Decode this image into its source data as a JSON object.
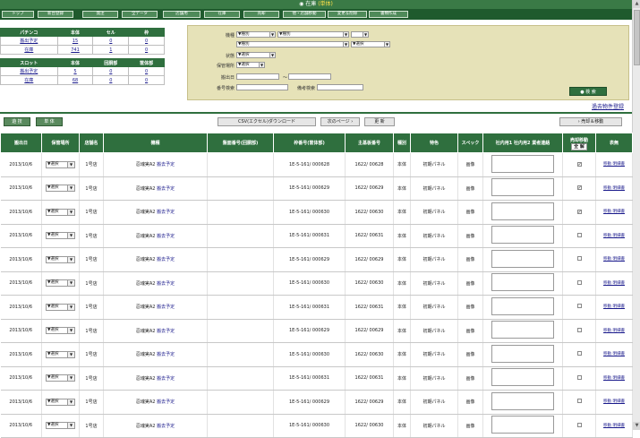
{
  "header": {
    "title": "在庫",
    "subtitle": "(単体)"
  },
  "nav": [
    "トップ",
    "新台登録",
    "発注",
    "全データ",
    "店舗用",
    "在庫",
    "売却",
    "他・店舗移動",
    "変更＆削除",
    "書類作成"
  ],
  "pachinko": {
    "headers": [
      "パチンコ",
      "本体",
      "セル",
      "枠"
    ],
    "rows": [
      {
        "label": "搬出予定",
        "c1": "15",
        "c2": "0",
        "c3": "0"
      },
      {
        "label": "在庫",
        "c1": "741",
        "c2": "1",
        "c3": "0"
      }
    ]
  },
  "slot": {
    "headers": [
      "スロット",
      "本体",
      "回胴部",
      "筐体部"
    ],
    "rows": [
      {
        "label": "搬出予定",
        "c1": "5",
        "c2": "0",
        "c3": "0"
      },
      {
        "label": "在庫",
        "c1": "68",
        "c2": "0",
        "c3": "0"
      }
    ]
  },
  "search": {
    "kind_label": "機種",
    "kind_sel1": "▼種別",
    "kind_sel2": "▼種別",
    "kind_sel3": "▼種別",
    "select_label": "▼選択",
    "state_label": "状態",
    "state_sel": "▼選択",
    "place_label": "保管場所",
    "place_sel": "▼選択",
    "date_label": "搬出日",
    "tilde": "〜",
    "number_label": "番号検索",
    "memo_label": "備考検索",
    "button": "検 索"
  },
  "past_link": "過去物件登録",
  "toolbar": {
    "btn1": "遊 技",
    "btn2": "単 体",
    "csv": "CSV(エクセル)ダウンロード",
    "next": "次のページ ›",
    "update": "更 新",
    "sell": "› 売却＆移動"
  },
  "columns": [
    "搬出日",
    "保管場所",
    "店舗名",
    "機種",
    "盤面番号(回胴部)",
    "枠番号(筐体部)",
    "主基板番号",
    "種別",
    "特色",
    "スペック",
    "社内用1 社内用2 業者連絡",
    "売却移動",
    "表無"
  ],
  "sellmove_all": "全 解",
  "rows": [
    {
      "date": "2013/10/6",
      "place": "▼選択",
      "store": "1号店",
      "maker": "忍魂実A2",
      "model": "搬去予定",
      "board": "",
      "frame": "1E-5-161/ 000628",
      "main": "1622/ 00628",
      "type": "本体",
      "feature": "初期パネル",
      "spec": "画像",
      "checked": true,
      "links": "移動 明細書"
    },
    {
      "date": "2013/10/6",
      "place": "▼選択",
      "store": "1号店",
      "maker": "忍魂実A2",
      "model": "搬去予定",
      "board": "",
      "frame": "1E-5-161/ 000629",
      "main": "1622/ 00629",
      "type": "本体",
      "feature": "初期パネル",
      "spec": "画像",
      "checked": true,
      "links": "移動 明細書"
    },
    {
      "date": "2013/10/6",
      "place": "▼選択",
      "store": "1号店",
      "maker": "忍魂実A2",
      "model": "搬去予定",
      "board": "",
      "frame": "1E-5-161/ 000630",
      "main": "1622/ 00630",
      "type": "本体",
      "feature": "初期パネル",
      "spec": "画像",
      "checked": true,
      "links": "移動 明細書"
    },
    {
      "date": "2013/10/6",
      "place": "▼選択",
      "store": "1号店",
      "maker": "忍魂実A2",
      "model": "搬去予定",
      "board": "",
      "frame": "1E-5-161/ 000631",
      "main": "1622/ 00631",
      "type": "本体",
      "feature": "初期パネル",
      "spec": "画像",
      "checked": false,
      "links": "移動 明細書"
    },
    {
      "date": "2013/10/6",
      "place": "▼選択",
      "store": "1号店",
      "maker": "忍魂実A2",
      "model": "搬去予定",
      "board": "",
      "frame": "1E-5-161/ 000629",
      "main": "1622/ 00629",
      "type": "本体",
      "feature": "初期パネル",
      "spec": "画像",
      "checked": false,
      "links": "移動 明細書"
    },
    {
      "date": "2013/10/6",
      "place": "▼選択",
      "store": "1号店",
      "maker": "忍魂実A2",
      "model": "搬去予定",
      "board": "",
      "frame": "1E-5-161/ 000630",
      "main": "1622/ 00630",
      "type": "本体",
      "feature": "初期パネル",
      "spec": "画像",
      "checked": false,
      "links": "移動 明細書"
    },
    {
      "date": "2013/10/6",
      "place": "▼選択",
      "store": "1号店",
      "maker": "忍魂実A2",
      "model": "搬去予定",
      "board": "",
      "frame": "1E-5-161/ 000631",
      "main": "1622/ 00631",
      "type": "本体",
      "feature": "初期パネル",
      "spec": "画像",
      "checked": false,
      "links": "移動 明細書"
    },
    {
      "date": "2013/10/6",
      "place": "▼選択",
      "store": "1号店",
      "maker": "忍魂実A2",
      "model": "搬去予定",
      "board": "",
      "frame": "1E-5-161/ 000629",
      "main": "1622/ 00629",
      "type": "本体",
      "feature": "初期パネル",
      "spec": "画像",
      "checked": false,
      "links": "移動 明細書"
    },
    {
      "date": "2013/10/6",
      "place": "▼選択",
      "store": "1号店",
      "maker": "忍魂実A2",
      "model": "搬去予定",
      "board": "",
      "frame": "1E-5-161/ 000630",
      "main": "1622/ 00630",
      "type": "本体",
      "feature": "初期パネル",
      "spec": "画像",
      "checked": false,
      "links": "移動 明細書"
    },
    {
      "date": "2013/10/6",
      "place": "▼選択",
      "store": "1号店",
      "maker": "忍魂実A2",
      "model": "搬去予定",
      "board": "",
      "frame": "1E-5-161/ 000631",
      "main": "1622/ 00631",
      "type": "本体",
      "feature": "初期パネル",
      "spec": "画像",
      "checked": false,
      "links": "移動 明細書"
    },
    {
      "date": "2013/10/6",
      "place": "▼選択",
      "store": "1号店",
      "maker": "忍魂実A2",
      "model": "搬去予定",
      "board": "",
      "frame": "1E-5-161/ 000629",
      "main": "1622/ 00629",
      "type": "本体",
      "feature": "初期パネル",
      "spec": "画像",
      "checked": false,
      "links": "移動 明細書"
    },
    {
      "date": "2013/10/6",
      "place": "▼選択",
      "store": "1号店",
      "maker": "忍魂実A2",
      "model": "搬去予定",
      "board": "",
      "frame": "1E-5-161/ 000630",
      "main": "1622/ 00630",
      "type": "本体",
      "feature": "初期パネル",
      "spec": "画像",
      "checked": false,
      "links": "移動 明細書"
    }
  ]
}
